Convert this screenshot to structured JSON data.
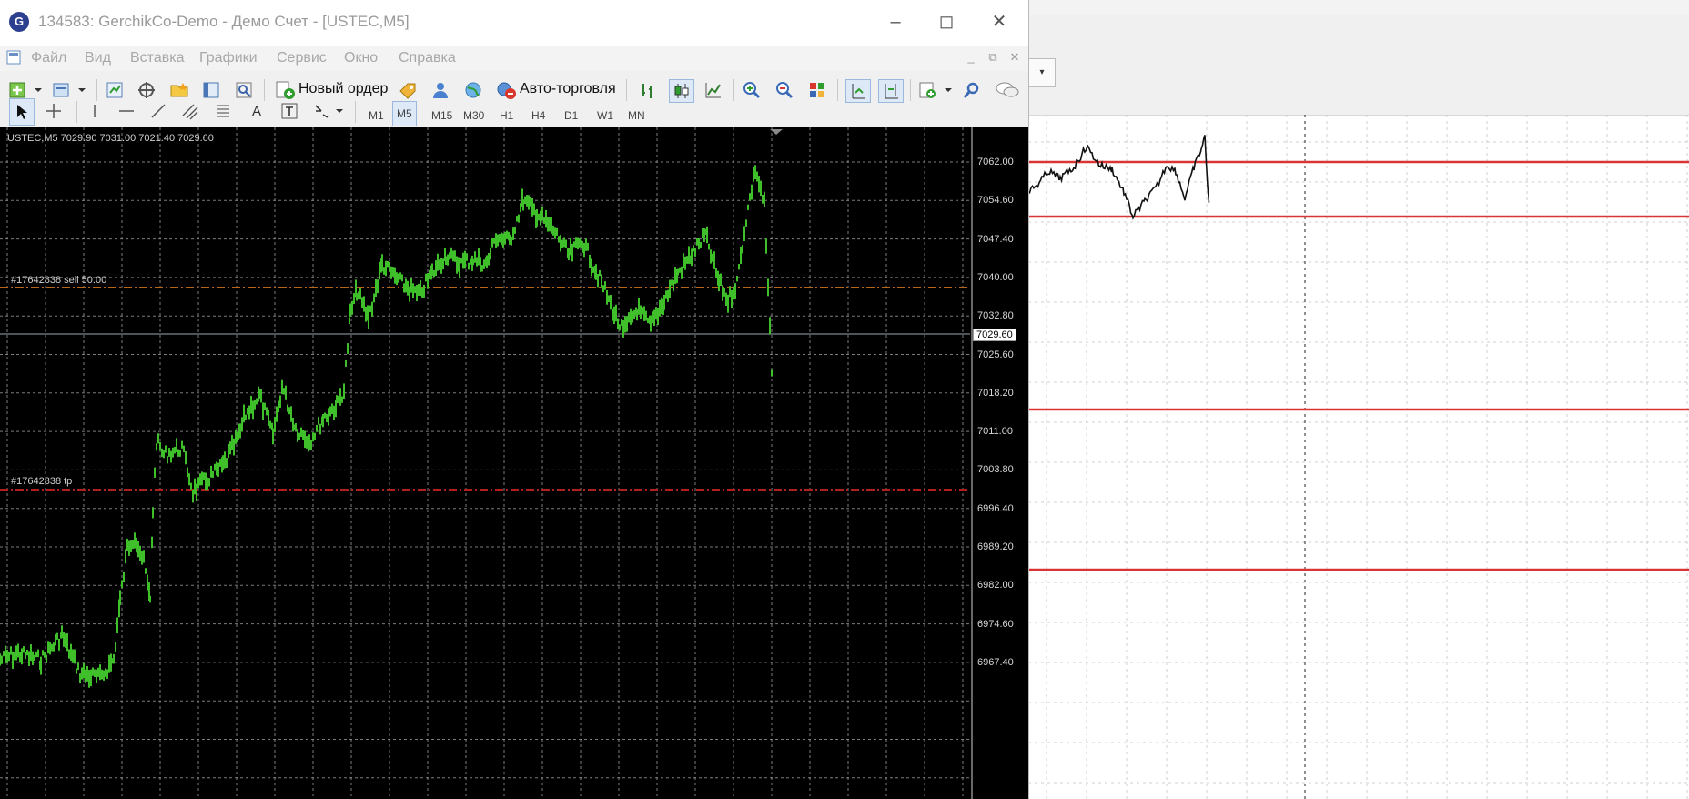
{
  "window": {
    "title": "134583: GerchikCo-Demo - Демо Счет - [USTEC,M5]",
    "app_icon_glyph": "G",
    "controls": [
      "minimize",
      "maximize",
      "close"
    ]
  },
  "menu": [
    "Файл",
    "Вид",
    "Вставка",
    "Графики",
    "Сервис",
    "Окно",
    "Справка"
  ],
  "toolbar1": {
    "new_order": "Новый ордер",
    "auto_trading": "Авто-торговля"
  },
  "timeframes": [
    "M1",
    "M5",
    "M15",
    "M30",
    "H1",
    "H4",
    "D1",
    "W1",
    "MN"
  ],
  "timeframe_active": "M5",
  "chart": {
    "header": "USTEC,M5  7029.90 7031.00 7021.40 7029.60",
    "order_label_sl": "#17642838 sell 50.00",
    "order_label_tp": "#17642838 tp",
    "current_price": "7029.60",
    "price_scale": [
      "7062.00",
      "7054.60",
      "7047.40",
      "7040.00",
      "7032.80",
      "7025.60",
      "7018.20",
      "7011.00",
      "7003.80",
      "6996.40",
      "6989.20",
      "6982.00",
      "6974.60",
      "6967.40"
    ],
    "colors": {
      "background": "#000000",
      "candles": "#3fbf2a",
      "grid": "#9a9a9a",
      "sell_line": "#b8661b",
      "tp_line": "#b21f1f"
    }
  },
  "background_chart": {
    "dropdown": "▾",
    "colors": {
      "levels": "#d93535",
      "price": "#111111"
    }
  }
}
